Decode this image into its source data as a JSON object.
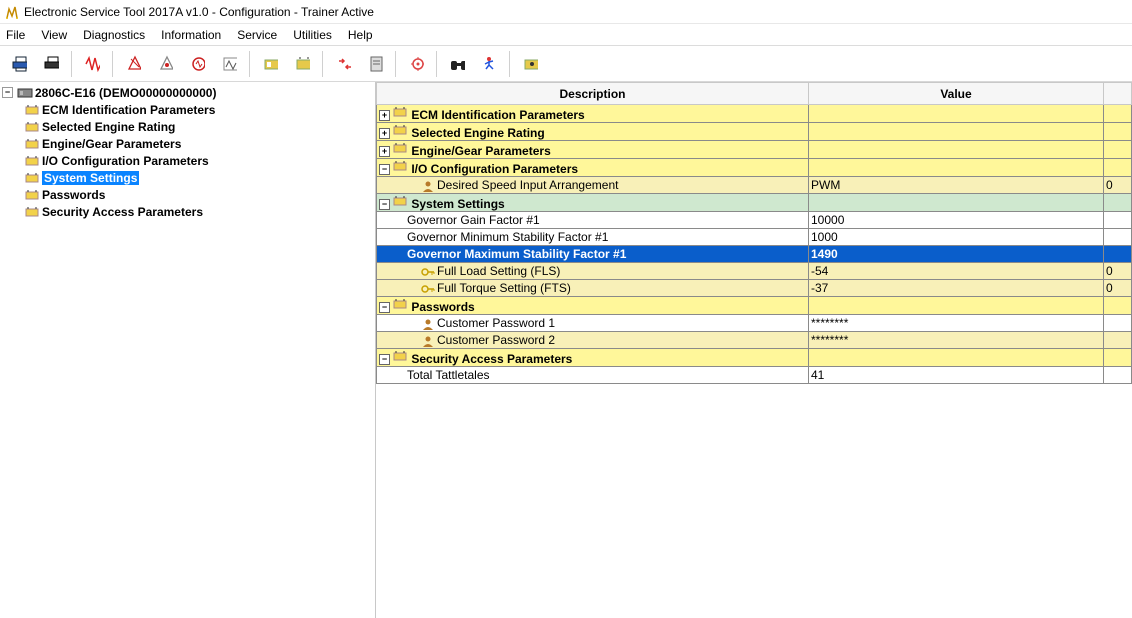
{
  "title": "Electronic Service Tool 2017A v1.0 - Configuration - Trainer Active",
  "menu": [
    "File",
    "View",
    "Diagnostics",
    "Information",
    "Service",
    "Utilities",
    "Help"
  ],
  "tree": {
    "root": "2806C-E16 (DEMO00000000000)",
    "children": [
      "ECM Identification Parameters",
      "Selected Engine Rating",
      "Engine/Gear Parameters",
      "I/O Configuration Parameters",
      "System Settings",
      "Passwords",
      "Security Access Parameters"
    ],
    "selectedIndex": 4
  },
  "columns": {
    "desc": "Description",
    "val": "Value"
  },
  "rows": [
    {
      "type": "grp",
      "toggle": "+",
      "icon": "cfg",
      "desc": "ECM Identification Parameters",
      "val": ""
    },
    {
      "type": "grp",
      "toggle": "+",
      "icon": "cfg",
      "desc": "Selected Engine Rating",
      "val": ""
    },
    {
      "type": "grp",
      "toggle": "+",
      "icon": "cfg",
      "desc": "Engine/Gear Parameters",
      "val": ""
    },
    {
      "type": "grp",
      "toggle": "-",
      "icon": "cfg",
      "desc": "I/O Configuration Parameters",
      "val": ""
    },
    {
      "type": "rowyellow",
      "indent": 2,
      "icon": "usr",
      "desc": "Desired Speed Input Arrangement",
      "val": "PWM",
      "extra": "0"
    },
    {
      "type": "grpgreen",
      "toggle": "-",
      "icon": "cfg",
      "desc": "System Settings",
      "val": ""
    },
    {
      "type": "rowwhite",
      "indent": 1,
      "desc": "Governor Gain Factor #1",
      "val": "10000"
    },
    {
      "type": "rowwhite",
      "indent": 1,
      "desc": "Governor Minimum Stability Factor #1",
      "val": "1000"
    },
    {
      "type": "selrow",
      "indent": 1,
      "desc": "Governor Maximum Stability Factor #1",
      "val": "1490"
    },
    {
      "type": "rowyellow",
      "indent": 2,
      "icon": "key",
      "desc": "Full Load Setting (FLS)",
      "val": "-54",
      "extra": "0"
    },
    {
      "type": "rowyellow",
      "indent": 2,
      "icon": "key",
      "desc": "Full Torque Setting (FTS)",
      "val": "-37",
      "extra": "0"
    },
    {
      "type": "grp",
      "toggle": "-",
      "icon": "cfg",
      "desc": "Passwords",
      "val": ""
    },
    {
      "type": "rowwhite",
      "indent": 2,
      "icon": "usr",
      "desc": "Customer Password 1",
      "val": "********"
    },
    {
      "type": "rowyellow",
      "indent": 2,
      "icon": "usr",
      "desc": "Customer Password 2",
      "val": "********"
    },
    {
      "type": "grp",
      "toggle": "-",
      "icon": "cfg",
      "desc": "Security Access Parameters",
      "val": ""
    },
    {
      "type": "rowwhite",
      "indent": 1,
      "desc": "Total Tattletales",
      "val": "41"
    }
  ]
}
